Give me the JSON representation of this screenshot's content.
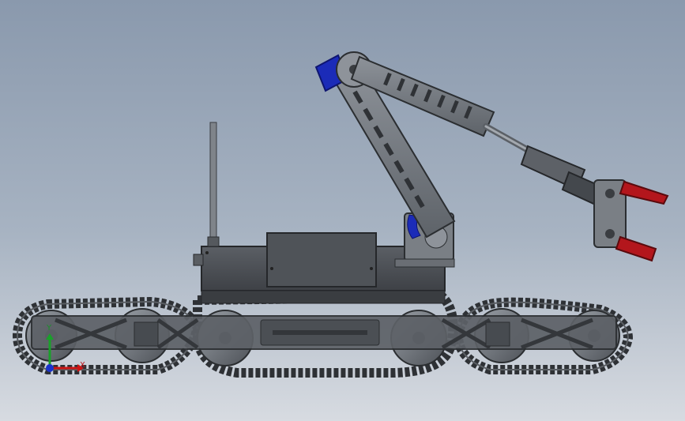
{
  "triad": {
    "x_label": "X",
    "y_label": "Y",
    "x_color": "#cc1515",
    "y_color": "#19a02a",
    "z_color": "#1a33cc"
  },
  "palette": {
    "track": "#3a3d41",
    "frame": "#55595f",
    "metal": "#7d8288",
    "body": "#4a4d52",
    "servo": "#1b2bb8",
    "jaw": "#b3161c"
  }
}
